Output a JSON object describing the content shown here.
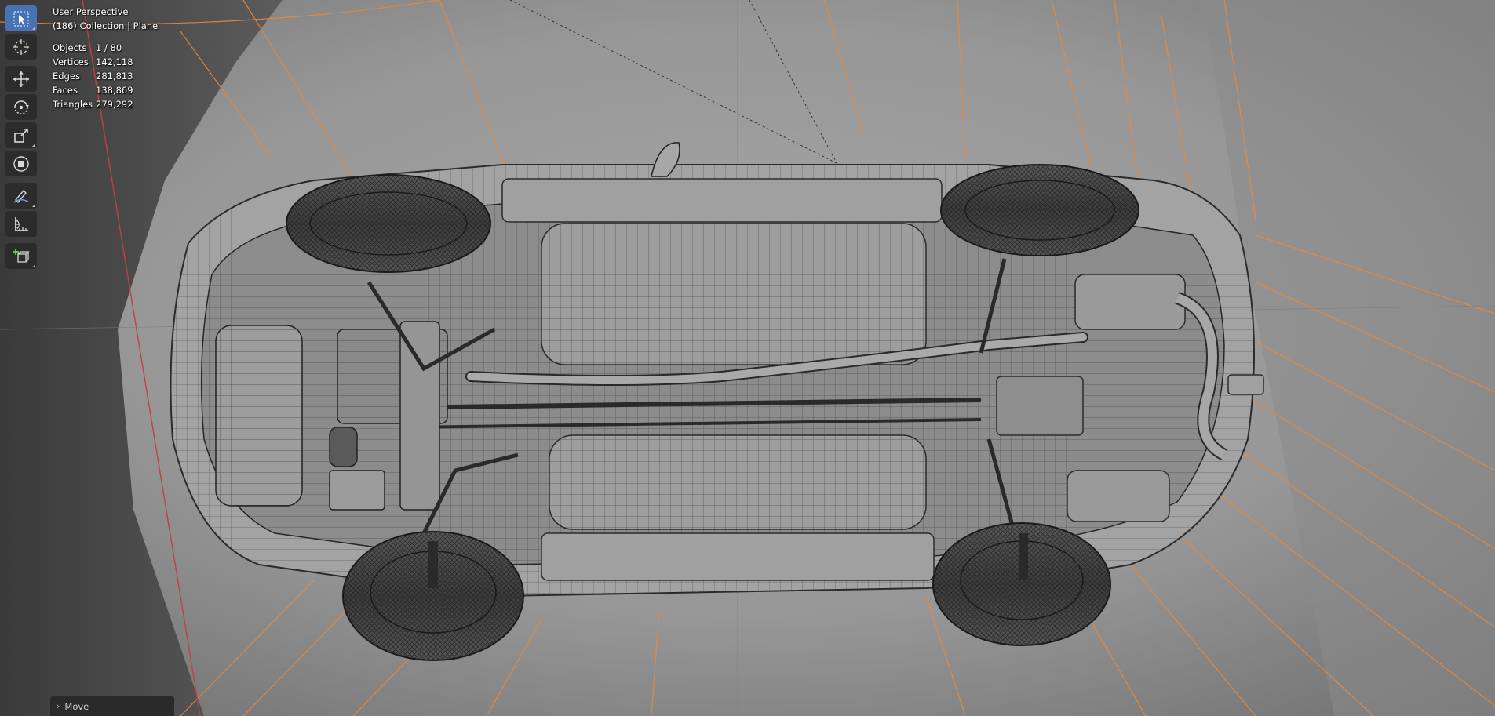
{
  "viewport": {
    "perspective_label": "User Perspective",
    "collection_label": "(186) Collection | Plane"
  },
  "stats": {
    "objects_label": "Objects",
    "objects_value": "1 / 80",
    "vertices_label": "Vertices",
    "vertices_value": "142,118",
    "edges_label": "Edges",
    "edges_value": "281,813",
    "faces_label": "Faces",
    "faces_value": "138,869",
    "triangles_label": "Triangles",
    "triangles_value": "279,292"
  },
  "toolbar": {
    "tools": [
      {
        "icon": "select-box-icon",
        "active": true
      },
      {
        "icon": "cursor-icon",
        "active": false
      },
      {
        "icon": "move-icon",
        "active": false
      },
      {
        "icon": "rotate-icon",
        "active": false
      },
      {
        "icon": "scale-icon",
        "active": false
      },
      {
        "icon": "transform-icon",
        "active": false
      },
      {
        "icon": "annotate-icon",
        "active": false
      },
      {
        "icon": "measure-icon",
        "active": false
      },
      {
        "icon": "add-cube-icon",
        "active": false
      }
    ]
  },
  "last_operation": {
    "label": "Move"
  },
  "colors": {
    "active_tool": "#4772b3",
    "wire_orange": "#e8893a",
    "axis_red": "#c0404a",
    "background_dark": "#3d3d3d",
    "background_mid": "#9a9a9a"
  }
}
